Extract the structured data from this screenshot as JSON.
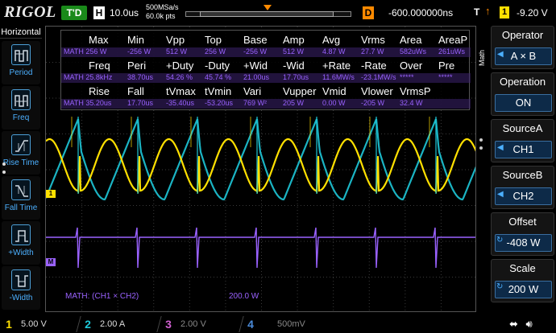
{
  "brand": "RIGOL",
  "top": {
    "run_state": "T'D",
    "horizontal_mode": "H",
    "timebase": "10.0us",
    "sample_rate": "500MSa/s",
    "memory_depth": "60.0k pts",
    "delay_mode": "D",
    "delay": "-600.000000ns",
    "trigger_label": "T",
    "trigger_edge": "rising",
    "trigger_source": "1",
    "trigger_level": "-9.20 V"
  },
  "left_menu": {
    "title": "Horizontal",
    "items": [
      {
        "label": "Period",
        "icon": "period-icon"
      },
      {
        "label": "Freq",
        "icon": "frequency-icon"
      },
      {
        "label": "Rise Time",
        "icon": "rise-time-icon"
      },
      {
        "label": "Fall Time",
        "icon": "fall-time-icon"
      },
      {
        "label": "+Width",
        "icon": "positive-width-icon"
      },
      {
        "label": "-Width",
        "icon": "negative-width-icon"
      }
    ]
  },
  "right_menu": {
    "side_label": "Math",
    "items": [
      {
        "header": "Operator",
        "value": "A × B",
        "control": "arrow"
      },
      {
        "header": "Operation",
        "value": "ON",
        "control": "none"
      },
      {
        "header": "SourceA",
        "value": "CH1",
        "control": "arrow"
      },
      {
        "header": "SourceB",
        "value": "CH2",
        "control": "arrow"
      },
      {
        "header": "Offset",
        "value": "-408 W",
        "control": "knob"
      },
      {
        "header": "Scale",
        "value": "200 W",
        "control": "knob"
      }
    ]
  },
  "measurements": {
    "row1_headers": [
      "Max",
      "Min",
      "Vpp",
      "Top",
      "Base",
      "Amp",
      "Avg",
      "Vrms",
      "Area",
      "AreaP"
    ],
    "row1_values": [
      "MATH 256 W",
      "-256 W",
      "512 W",
      "256 W",
      "-256 W",
      "512 W",
      "4.87 W",
      "27.7 W",
      "582uWs",
      "261uWs"
    ],
    "row2_headers": [
      "Freq",
      "Peri",
      "+Duty",
      "-Duty",
      "+Wid",
      "-Wid",
      "+Rate",
      "-Rate",
      "Over",
      "Pre"
    ],
    "row2_values": [
      "MATH 25.8kHz",
      "38.70us",
      "54.26 %",
      "45.74 %",
      "21.00us",
      "17.70us",
      "11.6MW/s",
      "-23.1MW/s",
      "*****",
      "*****"
    ],
    "row3_headers": [
      "Rise",
      "Fall",
      "tVmax",
      "tVmin",
      "Vari",
      "Vupper",
      "Vmid",
      "Vlower",
      "VrmsP"
    ],
    "row3_values": [
      "MATH 35.20us",
      "17.70us",
      "-35.40us",
      "-53.20us",
      "769 W²",
      "205 W",
      "0.00 W",
      "-205 W",
      "32.4 W"
    ]
  },
  "screen": {
    "ch1_marker": "1",
    "math_marker": "M",
    "trigger_marker": "T",
    "math_expression": "MATH: (CH1 × CH2)",
    "math_scale": "200.0 W"
  },
  "channels": [
    {
      "num": "1",
      "scale": "5.00 V",
      "color": "#ffe000"
    },
    {
      "num": "2",
      "scale": "2.00 A",
      "color": "#1ec8d8"
    },
    {
      "num": "3",
      "scale": "2.00 V",
      "color": "#d060d0"
    },
    {
      "num": "4",
      "scale": "500mV",
      "color": "#4a8ad8"
    }
  ],
  "colors": {
    "ch1": "#ffe000",
    "ch2": "#1ec8d8",
    "math": "#9a62ff",
    "trigger": "#ff8a00",
    "menu_accent": "#4cb0ff"
  },
  "status_icons": [
    "usb-icon",
    "speaker-icon"
  ]
}
